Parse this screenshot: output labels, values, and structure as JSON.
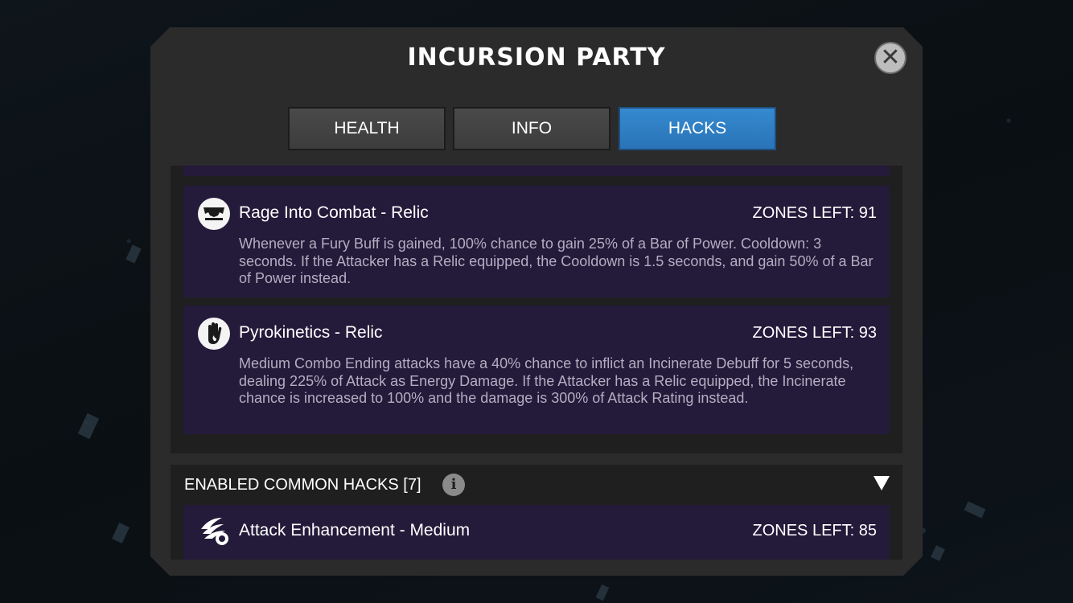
{
  "dialog": {
    "title": "INCURSION PARTY"
  },
  "tabs": [
    {
      "label": "HEALTH",
      "active": false
    },
    {
      "label": "INFO",
      "active": false
    },
    {
      "label": "HACKS",
      "active": true
    }
  ],
  "hacks": [
    {
      "name": "Rage Into Combat - Relic",
      "zones_left": "ZONES LEFT: 91",
      "icon": "fury-mask-icon",
      "description": "Whenever a Fury Buff is gained, 100% chance to gain 25% of a Bar of Power. Cooldown: 3 seconds. If the Attacker has a Relic equipped, the Cooldown is 1.5 seconds, and gain 50% of a Bar of Power instead."
    },
    {
      "name": "Pyrokinetics - Relic",
      "zones_left": "ZONES LEFT: 93",
      "icon": "flaming-hand-icon",
      "description": "Medium Combo Ending attacks have a 40% chance to inflict an Incinerate Debuff for 5 seconds, dealing 225% of Attack as Energy Damage. If the Attacker has a Relic equipped, the Incinerate chance is increased to 100% and the damage is 300% of Attack Rating instead."
    }
  ],
  "common_hacks": {
    "label": "ENABLED COMMON HACKS [7]",
    "items": [
      {
        "name": "Attack Enhancement - Medium",
        "zones_left": "ZONES LEFT: 85",
        "icon": "attack-burst-icon"
      }
    ]
  },
  "colors": {
    "active_tab": "#2f7fc4",
    "card_background": "#241a3a",
    "panel": "#2b2b2b"
  }
}
